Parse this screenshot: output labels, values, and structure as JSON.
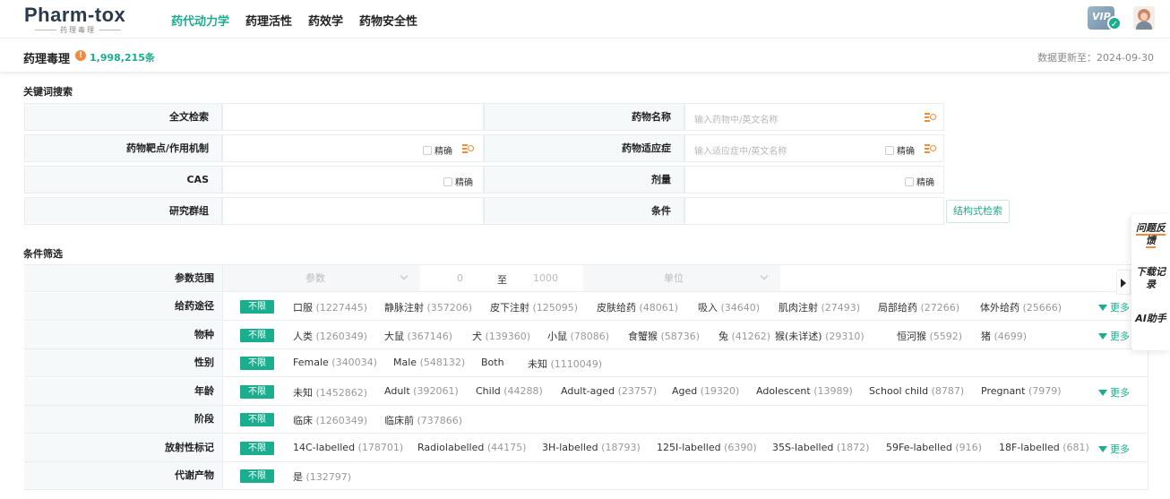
{
  "header": {
    "logo_main": "Pharm-tox",
    "logo_sub": "药理毒理",
    "nav": [
      "药代动力学",
      "药理活性",
      "药效学",
      "药物安全性"
    ],
    "vip_label": "VIP"
  },
  "title_bar": {
    "title": "药理毒理",
    "count": "1,998,215条",
    "updated": "数据更新至：2024-09-30"
  },
  "keyword_search": {
    "section_title": "关键词搜索",
    "fulltext_label": "全文检索",
    "drug_name_label": "药物名称",
    "drug_name_placeholder": "输入药物中/英文名称",
    "target_label": "药物靶点/作用机制",
    "indication_label": "药物适应症",
    "indication_placeholder": "输入适应症中/英文名称",
    "cas_label": "CAS",
    "dosage_label": "剂量",
    "group_label": "研究群组",
    "condition_label": "条件",
    "exact_label": "精确",
    "structure_search": "结构式检索"
  },
  "filters": {
    "section_title": "条件筛选",
    "param": {
      "label": "参数范围",
      "param_placeholder": "参数",
      "min": "0",
      "to": "至",
      "max": "1000",
      "unit_placeholder": "单位"
    },
    "unlimited": "不限",
    "more": "更多",
    "rows": [
      {
        "label": "给药途径",
        "options": [
          [
            "口服",
            "(1227445)"
          ],
          [
            "静脉注射",
            "(357206)"
          ],
          [
            "皮下注射",
            "(125095)"
          ],
          [
            "皮肤给药",
            "(48061)"
          ],
          [
            "吸入",
            "(34640)"
          ],
          [
            "肌肉注射",
            "(27493)"
          ],
          [
            "局部给药",
            "(27266)"
          ],
          [
            "体外给药",
            "(25666)"
          ]
        ]
      },
      {
        "label": "物种",
        "options": [
          [
            "人类",
            "(1260349)"
          ],
          [
            "大鼠",
            "(367146)"
          ],
          [
            "犬",
            "(139360)"
          ],
          [
            "小鼠",
            "(78086)"
          ],
          [
            "食蟹猴",
            "(58736)"
          ],
          [
            "兔",
            "(41262)"
          ],
          [
            "猴(未详述)",
            "(29310)"
          ],
          [
            "恒河猴",
            "(5592)"
          ],
          [
            "猪",
            "(4699)"
          ]
        ]
      },
      {
        "label": "性别",
        "options": [
          [
            "Female",
            "(340034)"
          ],
          [
            "Male",
            "(548132)"
          ],
          [
            "Both",
            ""
          ],
          [
            "未知",
            "(1110049)"
          ]
        ]
      },
      {
        "label": "年龄",
        "options": [
          [
            "未知",
            "(1452862)"
          ],
          [
            "Adult",
            "(392061)"
          ],
          [
            "Child",
            "(44288)"
          ],
          [
            "Adult-aged",
            "(23757)"
          ],
          [
            "Aged",
            "(19320)"
          ],
          [
            "Adolescent",
            "(13989)"
          ],
          [
            "School child",
            "(8787)"
          ],
          [
            "Pregnant",
            "(7979)"
          ]
        ]
      },
      {
        "label": "阶段",
        "options": [
          [
            "临床",
            "(1260349)"
          ],
          [
            "临床前",
            "(737866)"
          ]
        ]
      },
      {
        "label": "放射性标记",
        "options": [
          [
            "14C-labelled",
            "(178701)"
          ],
          [
            "Radiolabelled",
            "(44175)"
          ],
          [
            "3H-labelled",
            "(18793)"
          ],
          [
            "125I-labelled",
            "(6390)"
          ],
          [
            "35S-labelled",
            "(1872)"
          ],
          [
            "59Fe-labelled",
            "(916)"
          ],
          [
            "18F-labelled",
            "(681)"
          ]
        ]
      },
      {
        "label": "代谢产物",
        "options": [
          [
            "是",
            "(132797)"
          ]
        ]
      }
    ]
  },
  "side_panel": [
    "问题反馈",
    "下载记录",
    "AI助手"
  ]
}
